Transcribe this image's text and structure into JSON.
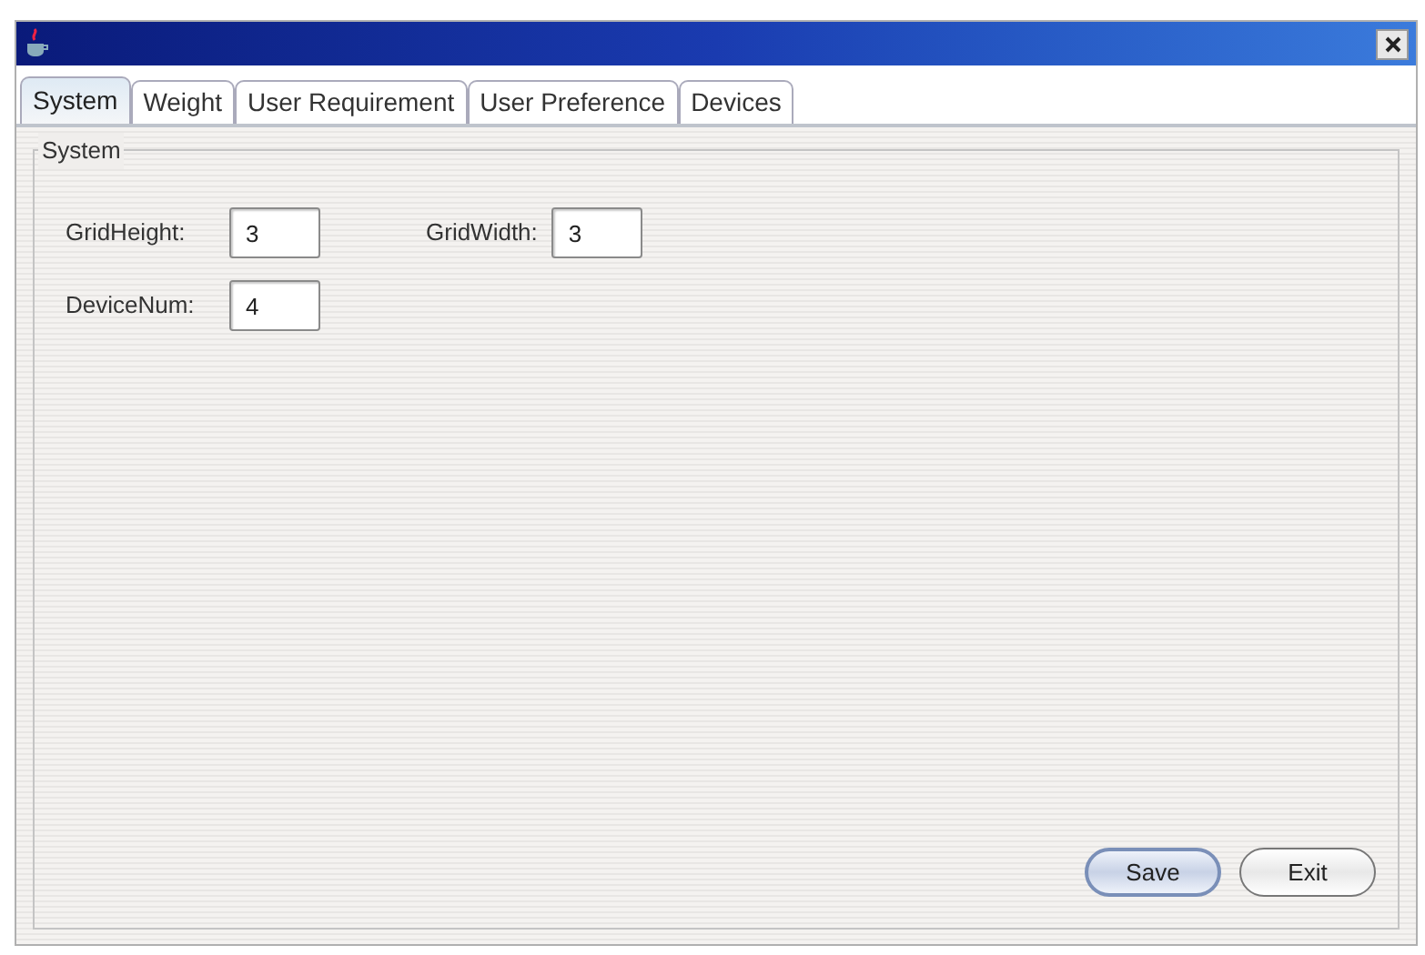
{
  "tabs": [
    {
      "label": "System",
      "selected": true
    },
    {
      "label": "Weight",
      "selected": false
    },
    {
      "label": "User Requirement",
      "selected": false
    },
    {
      "label": "User Preference",
      "selected": false
    },
    {
      "label": "Devices",
      "selected": false
    }
  ],
  "group": {
    "title": "System"
  },
  "fields": [
    {
      "label": "GridHeight:",
      "value": "3"
    },
    {
      "label": "GridWidth:",
      "value": "3"
    },
    {
      "label": "DeviceNum:",
      "value": "4"
    }
  ],
  "buttons": [
    {
      "label": "Save",
      "selected": true
    },
    {
      "label": "Exit",
      "selected": false
    }
  ]
}
